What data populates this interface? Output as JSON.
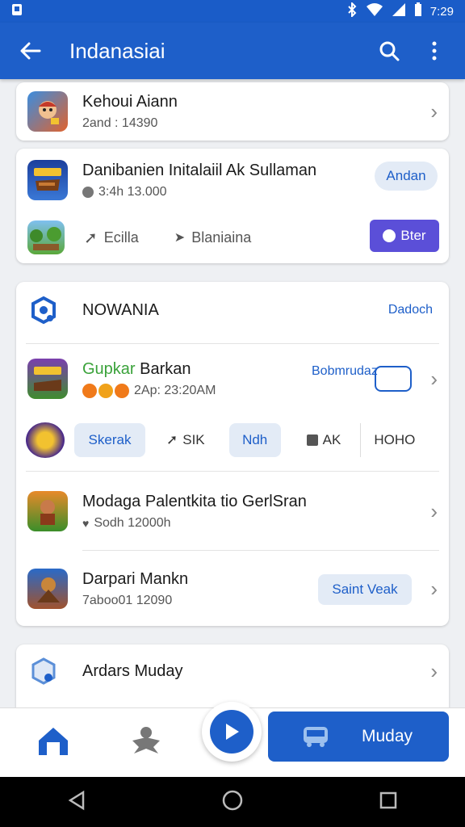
{
  "status": {
    "time": "7:29"
  },
  "appbar": {
    "title": "Indanasiai"
  },
  "card1": {
    "title": "Kehoui Aiann",
    "subtitle": "2and : 14390"
  },
  "card2": {
    "title": "Danibanien Initalaiil Ak Sullaman",
    "subtitle": "3:4h 13.000",
    "pill": "Andan",
    "action1": "Ecilla",
    "action2": "Blaniaina",
    "button": "Bter"
  },
  "card3": {
    "header": "NOWANIA",
    "header_link": "Dadoch",
    "item1": {
      "title_green": "Gupkar",
      "title_rest": " Barkan",
      "subtitle": "2Ap: 23:20AM",
      "link": "Bobmrudaz",
      "pill_inner": "daz"
    },
    "chips": [
      "Skerak",
      "SIK",
      "Ndh",
      "AK",
      "HOHO"
    ],
    "item2": {
      "title": "Modaga Palentkita tio GerlSran",
      "subtitle": "Sodh 12000h"
    },
    "item3": {
      "title": "Darpari Mankn",
      "subtitle": "7aboo01 12090",
      "pill": "Saint Veak"
    }
  },
  "card4": {
    "title": "Ardars Muday"
  },
  "bottomnav": {
    "fab_label": "Muday"
  }
}
